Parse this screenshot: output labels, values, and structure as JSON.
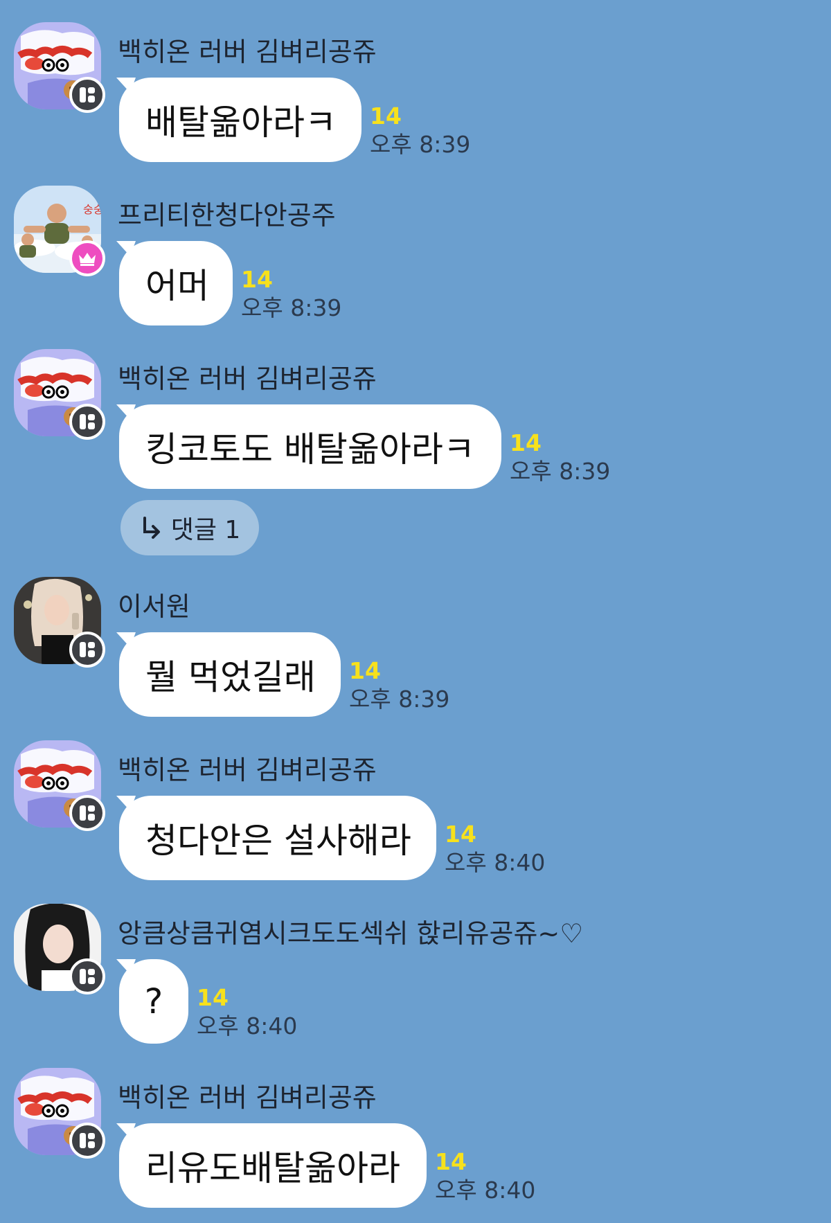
{
  "messages": [
    {
      "sender": "백히온 러버 김벼리공쥬",
      "text": "배탈옮아라ㅋ",
      "unread": "14",
      "time": "오후 8:39",
      "avatar": "shinchan-avatar-icon",
      "badge": "card-badge-icon"
    },
    {
      "sender": "프리티한청다안공주",
      "text": "어머",
      "unread": "14",
      "time": "오후 8:39",
      "avatar": "photo-avatar-icon",
      "badge": "crown-badge-icon"
    },
    {
      "sender": "백히온 러버 김벼리공쥬",
      "text": "킹코토도 배탈옮아라ㅋ",
      "unread": "14",
      "time": "오후 8:39",
      "avatar": "shinchan-avatar-icon",
      "badge": "card-badge-icon"
    },
    {
      "sender": "이서원",
      "text": "뭘 먹었길래",
      "unread": "14",
      "time": "오후 8:39",
      "avatar": "photo-avatar-icon",
      "badge": "card-badge-icon"
    },
    {
      "sender": "백히온 러버 김벼리공쥬",
      "text": "청다안은 설사해라",
      "unread": "14",
      "time": "오후 8:40",
      "avatar": "shinchan-avatar-icon",
      "badge": "card-badge-icon"
    },
    {
      "sender": "앙큼상큼귀염시크도도섹쉬 핝리유공쥬~♡",
      "text": "?",
      "unread": "14",
      "time": "오후 8:40",
      "avatar": "photo-avatar-icon",
      "badge": "card-badge-icon"
    },
    {
      "sender": "백히온 러버 김벼리공쥬",
      "text": "리유도배탈옮아라",
      "unread": "14",
      "time": "오후 8:40",
      "avatar": "shinchan-avatar-icon",
      "badge": "card-badge-icon"
    }
  ],
  "reply": {
    "label": "댓글 1",
    "icon": "reply-arrow-icon"
  },
  "colors": {
    "background": "#6b9fcf",
    "bubble": "#ffffff",
    "unread": "#f7e11d",
    "crown_badge": "#ee4dc0",
    "card_badge": "#3d3f44"
  }
}
